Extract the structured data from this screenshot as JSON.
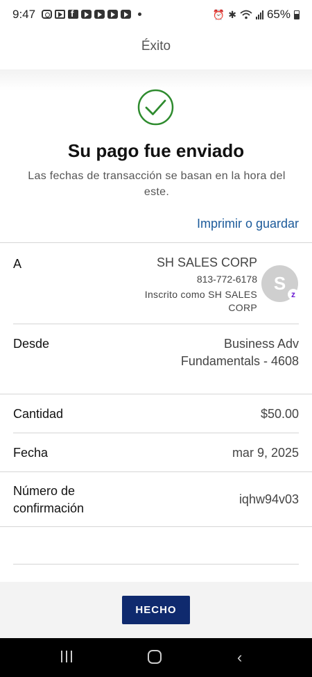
{
  "status_bar": {
    "time": "9:47",
    "battery": "65%",
    "left_icons": [
      "instagram-icon",
      "play-box-icon",
      "facebook-icon",
      "youtube-icon",
      "youtube-icon",
      "youtube-icon",
      "youtube-icon"
    ],
    "right_icons": [
      "alarm-icon",
      "bluetooth-icon",
      "wifi-icon",
      "signal-icon",
      "battery-icon"
    ]
  },
  "header": {
    "title": "Éxito"
  },
  "success": {
    "icon": "check-circle-icon",
    "accent_color": "#2e8b2e",
    "title": "Su pago fue enviado",
    "subtitle": "Las fechas de transacción se basan en la hora del este.",
    "print_link": "Imprimir o guardar"
  },
  "recipient": {
    "label": "A",
    "name": "SH SALES CORP",
    "phone": "813-772-6178",
    "registered_as": "Inscrito como SH SALES CORP",
    "avatar_letter": "S",
    "badge": "z"
  },
  "details": {
    "from_label": "Desde",
    "from_value": "Business Adv Fundamentals - 4608",
    "amount_label": "Cantidad",
    "amount_value": "$50.00",
    "date_label": "Fecha",
    "date_value": "mar 9, 2025",
    "confirmation_label": "Número de confirmación",
    "confirmation_value": "iqhw94v03"
  },
  "footer": {
    "done_button": "HECHO",
    "button_color": "#0f2a6e"
  },
  "nav_bar": {
    "icons": [
      "recents-icon",
      "home-icon",
      "back-icon"
    ]
  }
}
